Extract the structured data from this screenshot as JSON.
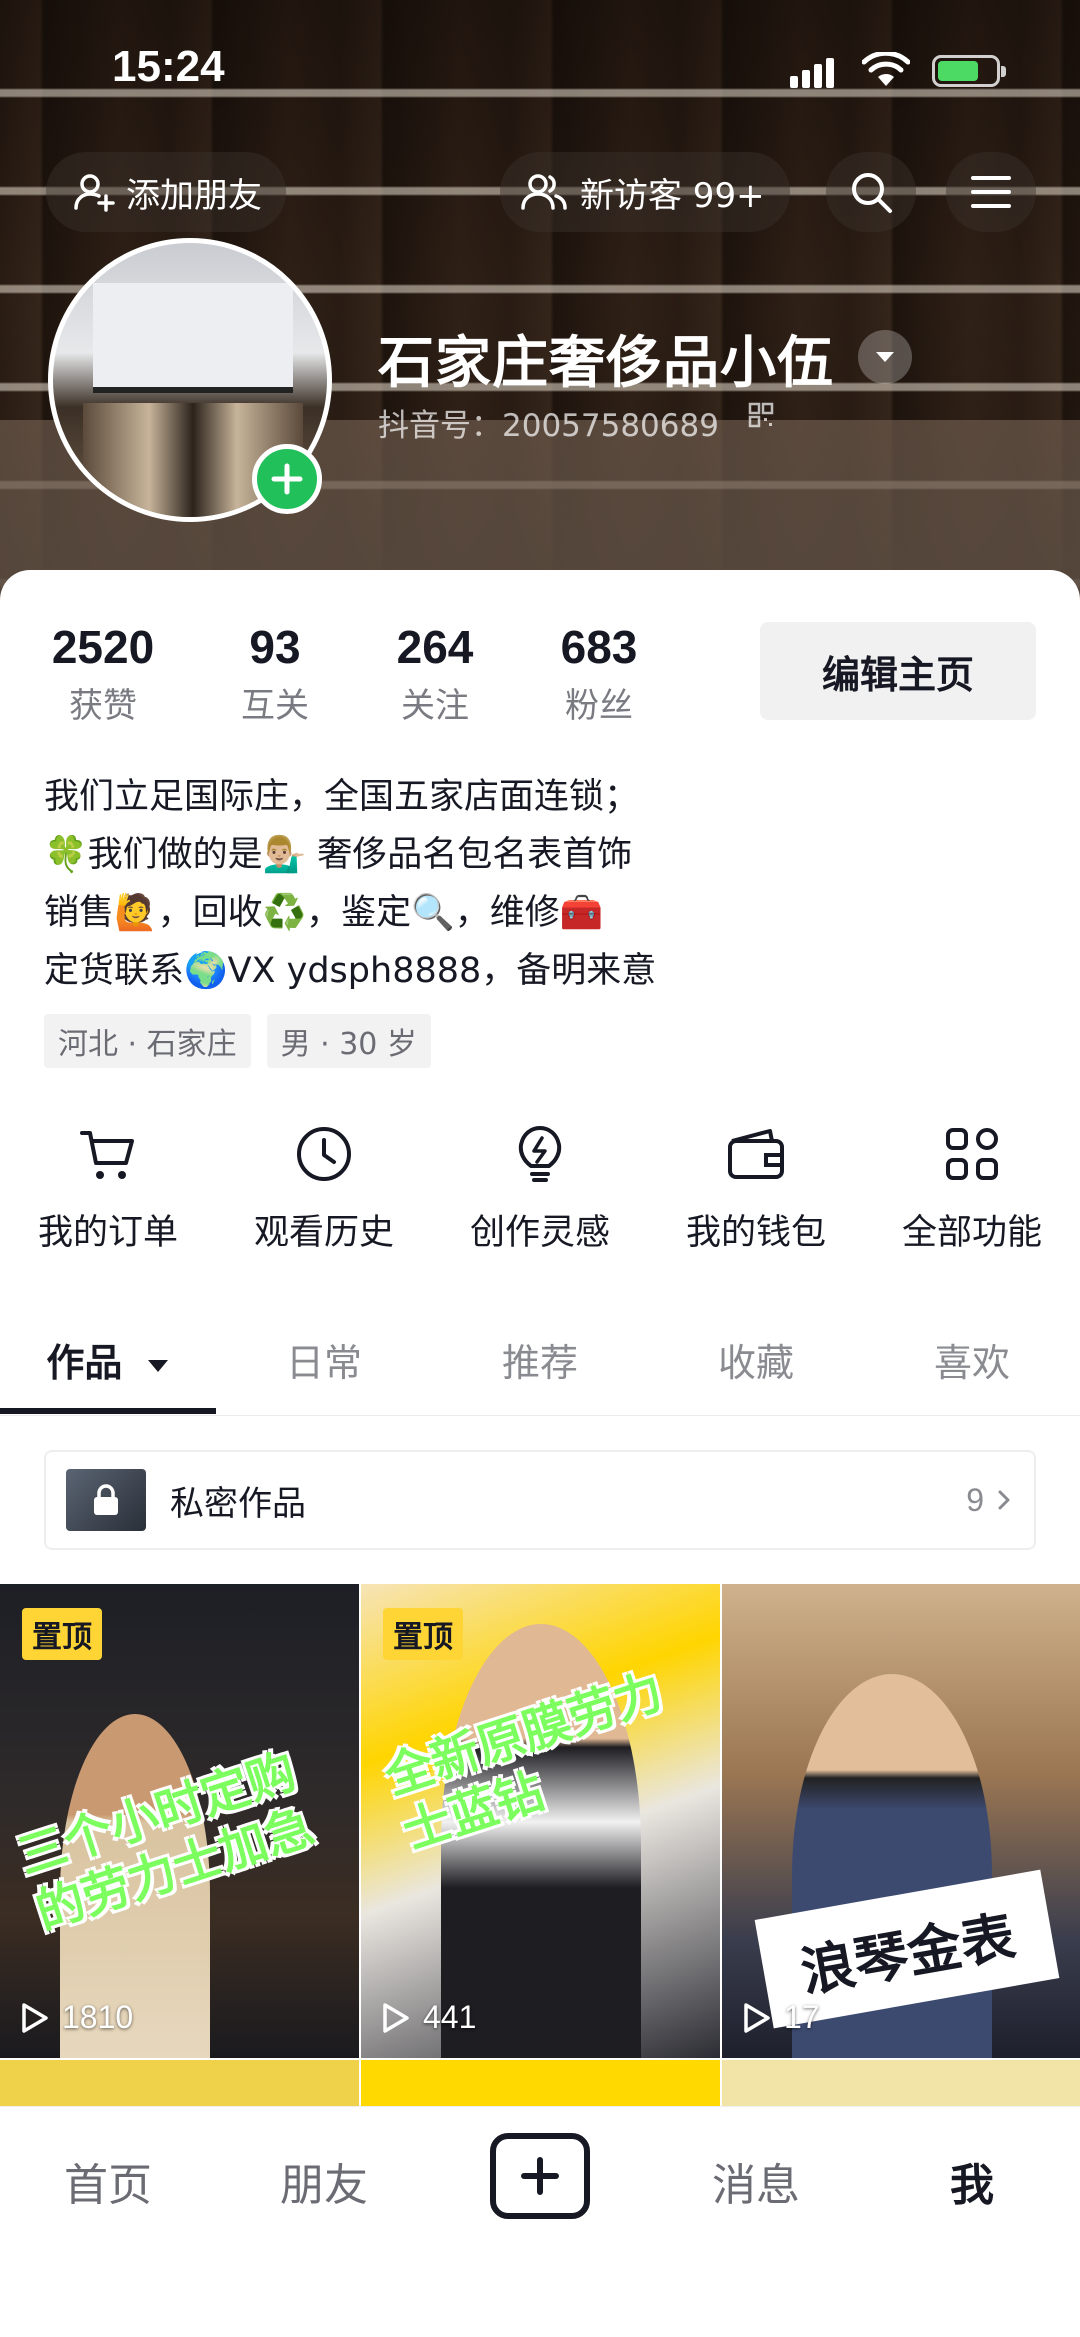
{
  "status_bar": {
    "time": "15:24"
  },
  "header": {
    "add_friend_label": "添加朋友",
    "new_visitors_label": "新访客 99+",
    "profile_name": "石家庄奢侈品小伍",
    "douyin_id": "抖音号：20057580689"
  },
  "stats": [
    {
      "value": "2520",
      "label": "获赞"
    },
    {
      "value": "93",
      "label": "互关"
    },
    {
      "value": "264",
      "label": "关注"
    },
    {
      "value": "683",
      "label": "粉丝"
    }
  ],
  "edit_profile_label": "编辑主页",
  "bio": {
    "line1": "我们立足国际庄，全国五家店面连锁；",
    "line2": "🍀我们做的是💁🏼‍♂️ 奢侈品名包名表首饰",
    "line3": "销售🙋，回收♻️，鉴定🔍，维修🧰",
    "line4": "定货联系🌍VX   ydsph8888，备明来意"
  },
  "tags": {
    "location": "河北 · 石家庄",
    "gender_age": "男 · 30 岁"
  },
  "functions": [
    {
      "label": "我的订单",
      "icon": "cart-icon"
    },
    {
      "label": "观看历史",
      "icon": "clock-icon"
    },
    {
      "label": "创作灵感",
      "icon": "bulb-icon"
    },
    {
      "label": "我的钱包",
      "icon": "wallet-icon"
    },
    {
      "label": "全部功能",
      "icon": "grid-icon"
    }
  ],
  "tabs": [
    {
      "label": "作品"
    },
    {
      "label": "日常"
    },
    {
      "label": "推荐"
    },
    {
      "label": "收藏"
    },
    {
      "label": "喜欢"
    }
  ],
  "private_works": {
    "label": "私密作品",
    "count": "9"
  },
  "videos": [
    {
      "pinned_label": "置顶",
      "caption": "三个小时定购\n的劳力士加急",
      "plays": "1810"
    },
    {
      "pinned_label": "置顶",
      "caption": "全新原膜劳力\n士蓝钻",
      "plays": "441"
    },
    {
      "pinned_label": "",
      "caption": "浪琴金表",
      "plays": "17"
    }
  ],
  "bottom_nav": {
    "home": "首页",
    "friends": "朋友",
    "messages": "消息",
    "me": "我"
  },
  "colors": {
    "accent_green": "#22c05a",
    "pin_yellow": "#ffd535",
    "text_primary": "#161823",
    "text_secondary": "#7a7b82"
  }
}
